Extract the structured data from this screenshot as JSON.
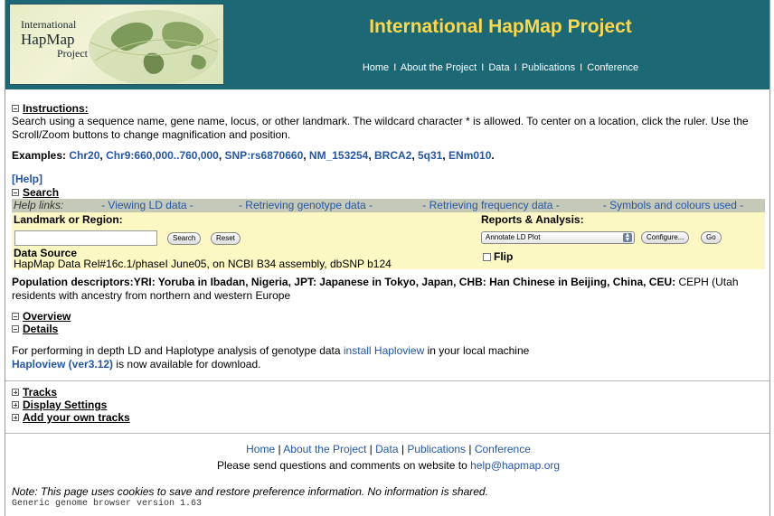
{
  "banner": {
    "logo": {
      "line1": "International",
      "line2": "HapMap",
      "line3": "Project"
    },
    "title": "International HapMap Project",
    "nav": [
      "Home",
      "About the Project",
      "Data",
      "Publications",
      "Conference"
    ],
    "nav_sep": "I",
    "colors": {
      "background": "#1c6874",
      "title": "#ffd84a"
    }
  },
  "instructions": {
    "title": "Instructions:",
    "text": "Search using a sequence name, gene name, locus, or other landmark. The wildcard character * is allowed. To center on a location, click the ruler. Use the Scroll/Zoom buttons to change magnification and position.",
    "examples_label": "Examples",
    "examples": [
      "Chr20",
      "Chr9:660,000..760,000",
      "SNP:rs6870660",
      "NM_153254",
      "BRCA2",
      "5q31",
      "ENm010"
    ]
  },
  "help": "[Help]",
  "search": {
    "title": "Search",
    "help_links_label": "Help links:",
    "help_links": [
      "- Viewing LD data -",
      "- Retrieving genotype data -",
      "- Retrieving frequency data -",
      "- Symbols and colours used -"
    ],
    "landmark_label": "Landmark or Region:",
    "input_value": "",
    "search_button": "Search",
    "reset_button": "Reset",
    "data_source_label": "Data Source",
    "data_source_text": "HapMap Data Rel#16c.1/phaseI June05, on NCBI B34 assembly, dbSNP b124",
    "reports_label": "Reports & Analysis:",
    "reports_selected": "Annotate LD Plot",
    "configure_button": "Configure...",
    "go_button": "Go",
    "flip_label": "Flip"
  },
  "population": {
    "label": "Population descriptors:",
    "text_bold": "YRI: Yoruba in Ibadan, Nigeria, JPT: Japanese in Tokyo, Japan, CHB: Han Chinese in Beijing, China, CEU:",
    "text_rest": " CEPH (Utah residents with ancestry from northern and western Europe"
  },
  "sections": {
    "overview": "Overview",
    "details": "Details"
  },
  "haploview": {
    "text1": "For performing in depth LD and Haplotype analysis of genotype data ",
    "link1": "install Haploview",
    "text2": " in your local machine",
    "link2": "Haploview (ver3.12)",
    "text3": " is now available for download."
  },
  "bottom_sections": {
    "tracks": "Tracks",
    "display": "Display Settings",
    "add_tracks": "Add your own tracks"
  },
  "footer": {
    "nav": [
      "Home",
      "About the Project",
      "Data",
      "Publications",
      "Conference"
    ],
    "nav_sep": "|",
    "contact_text": "Please send questions and comments on website to ",
    "contact_email": "help@hapmap.org",
    "note": "Note: This page uses cookies to save and restore preference information. No information is shared.",
    "version": "Generic genome browser version 1.63"
  }
}
